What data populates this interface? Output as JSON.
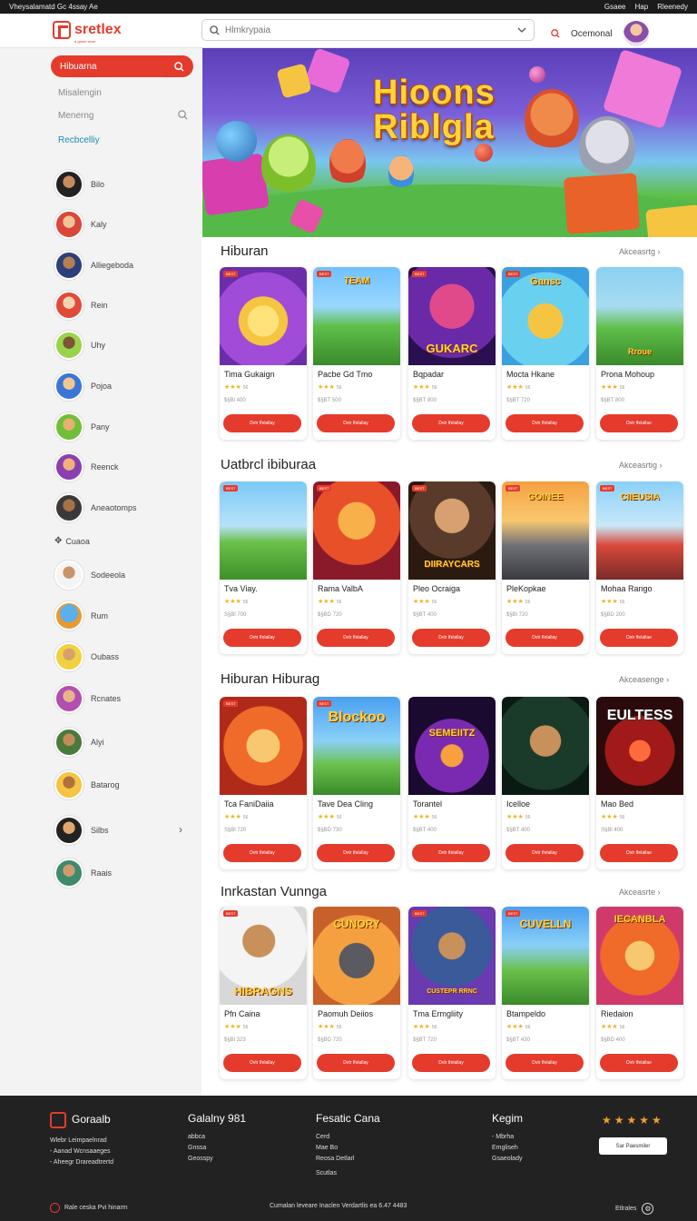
{
  "topbar": {
    "left_text": "Vheysalamatd Gc 4ssay Ae",
    "items": [
      "Gsaee",
      "Hap",
      "Rleenedy"
    ]
  },
  "header": {
    "logo_text": "sretlex",
    "logo_sub": "a game store",
    "search_placeholder": "Hlmkrypaia",
    "account_label": "Ocemonal"
  },
  "sidebar": {
    "active_label": "Hibuarna",
    "links": [
      "Misalengin",
      "Menerng",
      "Recbcelliy"
    ],
    "creators": [
      "Bilo",
      "Kaly",
      "Alliegeboda",
      "Rein",
      "Uhy",
      "Pojoa",
      "Pany",
      "Reenck",
      "Aneaotomps",
      "Cuaoa",
      "Sodeeola",
      "Rum",
      "Oubass",
      "Rcnates",
      "Alyi",
      "Batarog",
      "Silbs",
      "Raais"
    ]
  },
  "banner": {
    "title_line1": "Hioons",
    "title_line2": "Riblgla"
  },
  "sections": [
    {
      "title": "Hiburan",
      "see_all": "Akceasrtg",
      "games": [
        {
          "name": "Tima Gukaign",
          "price": "$§Bl 400",
          "reviews": "56",
          "badge": "BEST",
          "label": "",
          "button": "Dvtr Ifelallay"
        },
        {
          "name": "Pacbe Gd Tmo",
          "price": "$§BT 500",
          "reviews": "56",
          "badge": "BEST",
          "label": "TEAM",
          "button": "Dvtr Ifelallay"
        },
        {
          "name": "Bqpadar",
          "price": "$§BT 800",
          "reviews": "56",
          "badge": "BEST",
          "label": "GUKARC",
          "button": "Dvtr Ifelallay"
        },
        {
          "name": "Mocta Hkane",
          "price": "$§BT 720",
          "reviews": "56",
          "badge": "BEST",
          "label": "Gansc",
          "button": "Dvtr Ifelallay"
        },
        {
          "name": "Prona Mohoup",
          "price": "$§BT 800",
          "reviews": "56",
          "badge": "",
          "label": "Rroue",
          "button": "Dvtr Ifelallae"
        }
      ]
    },
    {
      "title": "Uatbrcl ibiburaa",
      "see_all": "Akceasrtig",
      "games": [
        {
          "name": "Tva Viay.",
          "price": "S§Bl 700",
          "reviews": "56",
          "badge": "BEST",
          "label": "",
          "button": "Dvtr Ifelallay"
        },
        {
          "name": "Rama ValbA",
          "price": "$§BD 720",
          "reviews": "56",
          "badge": "BEST",
          "label": "",
          "button": "Dvtr Ifelallay"
        },
        {
          "name": "Pleo Ocraiga",
          "price": "$§BT 400",
          "reviews": "56",
          "badge": "BEST",
          "label": "DIIRAYCARS",
          "button": "Dvtr Ifelallay"
        },
        {
          "name": "PleKopkae",
          "price": "$§Bl 720",
          "reviews": "56",
          "badge": "BEST",
          "label": "GOINEE",
          "button": "Dvtr Ifelallay"
        },
        {
          "name": "Mohaa Rango",
          "price": "$§BD 200",
          "reviews": "56",
          "badge": "BEST",
          "label": "CIIEUSIA",
          "button": "Dvtr Ifelallae"
        }
      ]
    },
    {
      "title": "Hiburan Hiburag",
      "see_all": "Akceasenge",
      "games": [
        {
          "name": "Tca FaniDaiia",
          "price": "S§Bl 720",
          "reviews": "56",
          "badge": "BEST",
          "label": "",
          "button": "Dvtr Ifelallay"
        },
        {
          "name": "Tave Dea Cling",
          "price": "$§BD 730",
          "reviews": "56",
          "badge": "BEST",
          "label": "Blockoo",
          "button": "Dvtr Ifelallay"
        },
        {
          "name": "Torantel",
          "price": "$§BT 400",
          "reviews": "56",
          "badge": "",
          "label": "SEMEIITZ",
          "button": "Dvtr Ifelallay"
        },
        {
          "name": "Icelloe",
          "price": "$§BT 400",
          "reviews": "56",
          "badge": "",
          "label": "",
          "button": "Dvtr Ifelallay"
        },
        {
          "name": "Mao Bed",
          "price": "S§Bl 400",
          "reviews": "56",
          "badge": "",
          "label": "EULTESS",
          "button": "Dvtr Ifelallae"
        }
      ]
    },
    {
      "title": "Inrkastan Vunnga",
      "see_all": "Akceasrte",
      "games": [
        {
          "name": "Pfn Caina",
          "price": "$§Bl 323",
          "reviews": "56",
          "badge": "BEST",
          "label": "HIBRAGNS",
          "button": "Dvtr Ifelallay"
        },
        {
          "name": "Paomuh Deiios",
          "price": "$§BD 720",
          "reviews": "56",
          "badge": "",
          "label": "CUNORY",
          "button": "Dvtr Ifelallay"
        },
        {
          "name": "Tma Ermgliity",
          "price": "$§BT 720",
          "reviews": "56",
          "badge": "BEST",
          "label": "CUSTEPR RRNC",
          "button": "Dvtr Ifelallay"
        },
        {
          "name": "Btampeldo",
          "price": "$§BT 430",
          "reviews": "56",
          "badge": "BEST",
          "label": "CUVELLN",
          "button": "Dvtr Ifelallay"
        },
        {
          "name": "Riedaion",
          "price": "$§BD 400",
          "reviews": "56",
          "badge": "",
          "label": "IECANBLA",
          "button": "Dvtr Ifelallae"
        }
      ]
    }
  ],
  "footer": {
    "brand": {
      "name": "Goraalb",
      "lines": [
        "Wlebr Leimpaelnrad",
        "- Aanad Wcnsaaeges",
        "- Aheegr Drareadtrertd"
      ]
    },
    "col2": {
      "title": "Galalny 981",
      "items": [
        "abbca",
        "Gnssa",
        "Geosspy"
      ]
    },
    "col3": {
      "title": "Fesatic Cana",
      "items": [
        "Cerd",
        "Mae Bo",
        "Reosa Detlarl",
        "Scutlas"
      ]
    },
    "col4": {
      "title": "Kegim",
      "items": [
        "- Mbrha",
        "Emgliseh",
        "Gsaeolady"
      ]
    },
    "rating_stars": "★★★★★",
    "subscribe_button": "Sar Paesmiler",
    "bottom_left": "Rale ceska Pvi hinarm",
    "bottom_center": "Cumalan leveare Inaclen Verdartlis ea 6.47 4483",
    "bottom_right": "Etlrales"
  },
  "colors": {
    "accent": "#e53b2c",
    "sidebar_bg": "#f3f3f3",
    "footer_bg": "#222222",
    "star": "#f0b323"
  }
}
